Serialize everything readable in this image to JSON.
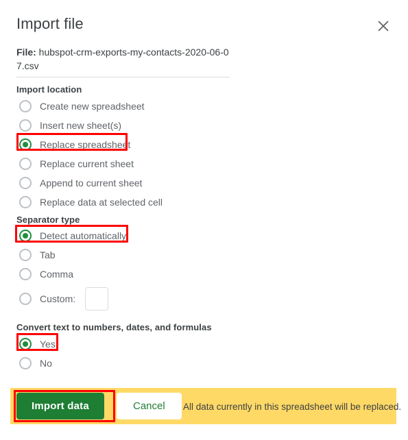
{
  "dialog": {
    "title": "Import file",
    "close_icon": "close-icon"
  },
  "file": {
    "label": "File:",
    "name": "hubspot-crm-exports-my-contacts-2020-06-07.csv"
  },
  "import_location": {
    "heading": "Import location",
    "options": [
      {
        "label": "Create new spreadsheet",
        "selected": false,
        "highlighted": false
      },
      {
        "label": "Insert new sheet(s)",
        "selected": false,
        "highlighted": false
      },
      {
        "label": "Replace spreadsheet",
        "selected": true,
        "highlighted": true
      },
      {
        "label": "Replace current sheet",
        "selected": false,
        "highlighted": false
      },
      {
        "label": "Append to current sheet",
        "selected": false,
        "highlighted": false
      },
      {
        "label": "Replace data at selected cell",
        "selected": false,
        "highlighted": false
      }
    ]
  },
  "separator_type": {
    "heading": "Separator type",
    "options": [
      {
        "label": "Detect automatically",
        "selected": true,
        "highlighted": true
      },
      {
        "label": "Tab",
        "selected": false,
        "highlighted": false
      },
      {
        "label": "Comma",
        "selected": false,
        "highlighted": false
      },
      {
        "label": "Custom:",
        "selected": false,
        "highlighted": false
      }
    ],
    "custom_value": "",
    "custom_placeholder": ""
  },
  "convert_text": {
    "heading": "Convert text to numbers, dates, and formulas",
    "options": [
      {
        "label": "Yes",
        "selected": true,
        "highlighted": true
      },
      {
        "label": "No",
        "selected": false,
        "highlighted": false
      }
    ]
  },
  "footer": {
    "import_label": "Import data",
    "cancel_label": "Cancel",
    "note": "All data currently in this spreadsheet will be replaced."
  },
  "colors": {
    "accent_green": "#1e8e3e",
    "button_green": "#1e7e34",
    "warning_yellow": "#ffd966",
    "annotation_red": "#ff0000",
    "text_primary": "#3c4043",
    "text_secondary": "#5f6368"
  }
}
